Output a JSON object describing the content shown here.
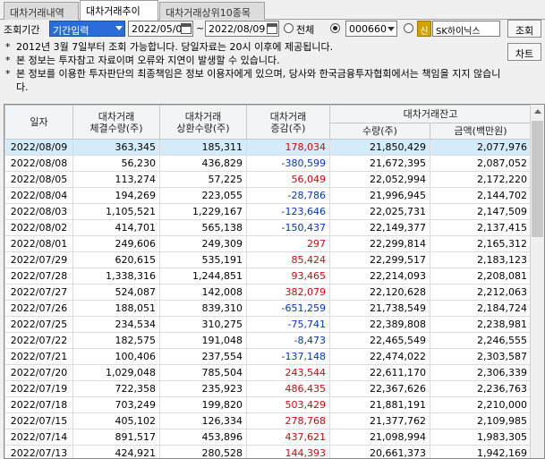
{
  "tabs": [
    "대차거래내역",
    "대차거래추이",
    "대차거래상위10종목"
  ],
  "query": {
    "period_label": "조회기간",
    "period_type": "기간입력",
    "start_date": "2022/05/09",
    "tilde": "~",
    "end_date": "2022/08/09",
    "radio_all_label": "전체",
    "stock_code": "000660",
    "shin_label": "신",
    "stock_name": "SK하이닉스",
    "search_button": "조회",
    "chart_button": "차트"
  },
  "notices": [
    "2012년 3월 7일부터 조회 가능합니다. 당일자료는 20시 이후에 제공됩니다.",
    "본 정보는 투자참고 자료이며 오류와 지연이 발생할 수 있습니다.",
    "본 정보를 이용한 투자판단의 최종책임은 정보 이용자에게 있으며, 당사와 한국금융투자협회에서는 책임을 지지 않습니다."
  ],
  "notice_star": "*",
  "table": {
    "headers": {
      "date": "일자",
      "exec1": "대차거래",
      "exec2": "체결수량(주)",
      "repay1": "대차거래",
      "repay2": "상환수량(주)",
      "change1": "대차거래",
      "change2": "증감(주)",
      "balance": "대차거래잔고",
      "qty": "수량(주)",
      "amount": "금액(백만원)"
    },
    "rows": [
      {
        "date": "2022/08/09",
        "exec": "363,345",
        "repay": "185,311",
        "change": "178,034",
        "qty": "21,850,429",
        "amount": "2,077,976"
      },
      {
        "date": "2022/08/08",
        "exec": "56,230",
        "repay": "436,829",
        "change": "-380,599",
        "qty": "21,672,395",
        "amount": "2,087,052"
      },
      {
        "date": "2022/08/05",
        "exec": "113,274",
        "repay": "57,225",
        "change": "56,049",
        "qty": "22,052,994",
        "amount": "2,172,220"
      },
      {
        "date": "2022/08/04",
        "exec": "194,269",
        "repay": "223,055",
        "change": "-28,786",
        "qty": "21,996,945",
        "amount": "2,144,702"
      },
      {
        "date": "2022/08/03",
        "exec": "1,105,521",
        "repay": "1,229,167",
        "change": "-123,646",
        "qty": "22,025,731",
        "amount": "2,147,509"
      },
      {
        "date": "2022/08/02",
        "exec": "414,701",
        "repay": "565,138",
        "change": "-150,437",
        "qty": "22,149,377",
        "amount": "2,137,415"
      },
      {
        "date": "2022/08/01",
        "exec": "249,606",
        "repay": "249,309",
        "change": "297",
        "qty": "22,299,814",
        "amount": "2,165,312"
      },
      {
        "date": "2022/07/29",
        "exec": "620,615",
        "repay": "535,191",
        "change": "85,424",
        "qty": "22,299,517",
        "amount": "2,183,123"
      },
      {
        "date": "2022/07/28",
        "exec": "1,338,316",
        "repay": "1,244,851",
        "change": "93,465",
        "qty": "22,214,093",
        "amount": "2,208,081"
      },
      {
        "date": "2022/07/27",
        "exec": "524,087",
        "repay": "142,008",
        "change": "382,079",
        "qty": "22,120,628",
        "amount": "2,212,063"
      },
      {
        "date": "2022/07/26",
        "exec": "188,051",
        "repay": "839,310",
        "change": "-651,259",
        "qty": "21,738,549",
        "amount": "2,184,724"
      },
      {
        "date": "2022/07/25",
        "exec": "234,534",
        "repay": "310,275",
        "change": "-75,741",
        "qty": "22,389,808",
        "amount": "2,238,981"
      },
      {
        "date": "2022/07/22",
        "exec": "182,575",
        "repay": "191,048",
        "change": "-8,473",
        "qty": "22,465,549",
        "amount": "2,246,555"
      },
      {
        "date": "2022/07/21",
        "exec": "100,406",
        "repay": "237,554",
        "change": "-137,148",
        "qty": "22,474,022",
        "amount": "2,303,587"
      },
      {
        "date": "2022/07/20",
        "exec": "1,029,048",
        "repay": "785,504",
        "change": "243,544",
        "qty": "22,611,170",
        "amount": "2,306,339"
      },
      {
        "date": "2022/07/19",
        "exec": "722,358",
        "repay": "235,923",
        "change": "486,435",
        "qty": "22,367,626",
        "amount": "2,236,763"
      },
      {
        "date": "2022/07/18",
        "exec": "703,249",
        "repay": "199,820",
        "change": "503,429",
        "qty": "21,881,191",
        "amount": "2,210,000"
      },
      {
        "date": "2022/07/15",
        "exec": "405,102",
        "repay": "126,334",
        "change": "278,768",
        "qty": "21,377,762",
        "amount": "2,109,985"
      },
      {
        "date": "2022/07/14",
        "exec": "891,517",
        "repay": "453,896",
        "change": "437,621",
        "qty": "21,098,994",
        "amount": "1,983,305"
      },
      {
        "date": "2022/07/13",
        "exec": "424,921",
        "repay": "280,528",
        "change": "144,393",
        "qty": "20,661,373",
        "amount": "1,942,169"
      }
    ]
  },
  "colors": {
    "positive": "#e0000b",
    "negative": "#0033d0",
    "selected_row": "#d4ecfa",
    "select_bg": "#2a6cd9"
  }
}
